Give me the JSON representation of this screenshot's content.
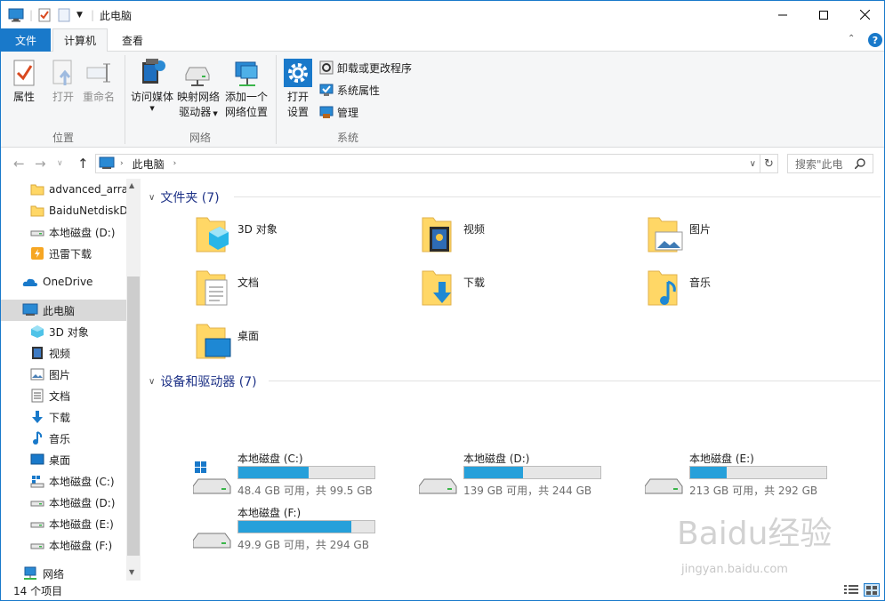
{
  "window": {
    "title": "此电脑"
  },
  "tabs": {
    "file": "文件",
    "computer": "计算机",
    "view": "查看"
  },
  "ribbon": {
    "location": {
      "properties": "属性",
      "open": "打开",
      "rename": "重命名",
      "group": "位置"
    },
    "network": {
      "media": "访问媒体",
      "map_line1": "映射网络",
      "map_line2": "驱动器",
      "add_line1": "添加一个",
      "add_line2": "网络位置",
      "group": "网络"
    },
    "system": {
      "settings_line1": "打开",
      "settings_line2": "设置",
      "uninstall": "卸载或更改程序",
      "sysprops": "系统属性",
      "manage": "管理",
      "group": "系统"
    }
  },
  "address": {
    "path": "此电脑",
    "search_placeholder": "搜索\"此电"
  },
  "nav": {
    "items": [
      {
        "label": "advanced_arra"
      },
      {
        "label": "BaiduNetdiskD"
      },
      {
        "label": "本地磁盘 (D:)"
      },
      {
        "label": "迅雷下载"
      },
      {
        "label": "OneDrive"
      },
      {
        "label": "此电脑"
      },
      {
        "label": "3D 对象"
      },
      {
        "label": "视频"
      },
      {
        "label": "图片"
      },
      {
        "label": "文档"
      },
      {
        "label": "下载"
      },
      {
        "label": "音乐"
      },
      {
        "label": "桌面"
      },
      {
        "label": "本地磁盘 (C:)"
      },
      {
        "label": "本地磁盘 (D:)"
      },
      {
        "label": "本地磁盘 (E:)"
      },
      {
        "label": "本地磁盘 (F:)"
      },
      {
        "label": "网络"
      }
    ]
  },
  "folders_section": {
    "title": "文件夹 (7)"
  },
  "folders": [
    {
      "label": "3D 对象"
    },
    {
      "label": "视频"
    },
    {
      "label": "图片"
    },
    {
      "label": "文档"
    },
    {
      "label": "下载"
    },
    {
      "label": "音乐"
    },
    {
      "label": "桌面"
    }
  ],
  "drives_section": {
    "title": "设备和驱动器 (7)"
  },
  "drives": [
    {
      "label": "本地磁盘 (C:)",
      "free": "48.4 GB 可用，共 99.5 GB",
      "used_fraction": 0.514
    },
    {
      "label": "本地磁盘 (D:)",
      "free": "139 GB 可用，共 244 GB",
      "used_fraction": 0.43
    },
    {
      "label": "本地磁盘 (E:)",
      "free": "213 GB 可用，共 292 GB",
      "used_fraction": 0.27
    },
    {
      "label": "本地磁盘 (F:)",
      "free": "49.9 GB 可用，共 294 GB",
      "used_fraction": 0.83
    }
  ],
  "status": {
    "count": "14 个项目"
  },
  "watermark": {
    "main": "Baidu经验",
    "sub": "jingyan.baidu.com"
  }
}
